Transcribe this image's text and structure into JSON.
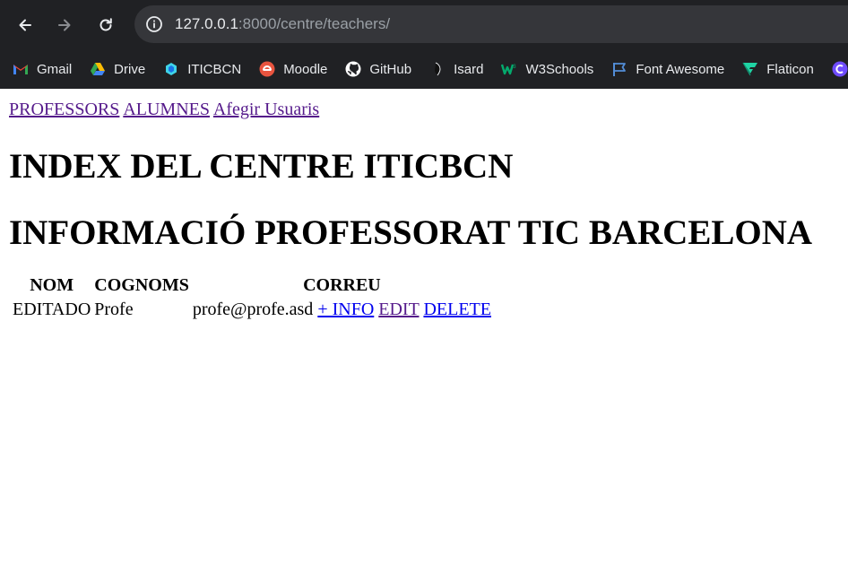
{
  "browser": {
    "url_host": "127.0.0.1",
    "url_rest": ":8000/centre/teachers/",
    "bookmarks": [
      "Gmail",
      "Drive",
      "ITICBCN",
      "Moodle",
      "GitHub",
      "Isard",
      "W3Schools",
      "Font Awesome",
      "Flaticon"
    ]
  },
  "nav": {
    "links": [
      "PROFESSORS",
      "ALUMNES",
      "Afegir Usuaris"
    ]
  },
  "headings": {
    "title": "INDEX DEL CENTRE ITICBCN",
    "subtitle": "INFORMACIÓ PROFESSORAT TIC BARCELONA"
  },
  "table": {
    "headers": [
      "NOM",
      "COGNOMS",
      "CORREU"
    ],
    "rows": [
      {
        "nom": "EDITADO",
        "cognoms": "Profe",
        "correu": "profe@profe.asd",
        "info": "+ INFO",
        "edit": "EDIT",
        "delete": "DELETE"
      }
    ]
  },
  "colors": {
    "chrome_bg": "#202124",
    "omnibox_bg": "#35363a",
    "link": "#0000ee",
    "link_visited": "#551a8b"
  }
}
